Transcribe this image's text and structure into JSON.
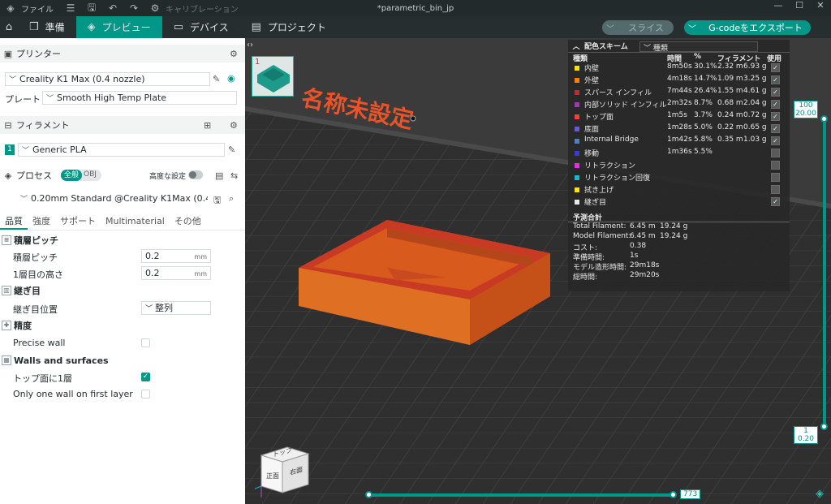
{
  "titlebar": {
    "file_label": "ファイル",
    "calibration_label": "キャリブレーション",
    "document_title": "*parametric_bin_jp"
  },
  "nav": {
    "prepare": "準備",
    "preview": "プレビュー",
    "device": "デバイス",
    "project": "プロジェクト",
    "slice": "スライス",
    "export": "G-codeをエクスポート"
  },
  "printer": {
    "section": "プリンター",
    "value": "Creality K1 Max (0.4 nozzle)",
    "plate_label": "プレート",
    "plate_value": "Smooth High Temp Plate"
  },
  "filament": {
    "section": "フィラメント",
    "index": "1",
    "value": "Generic PLA"
  },
  "process": {
    "section": "プロセス",
    "global": "全般",
    "obj": "OBJ",
    "advanced": "高度な設定",
    "preset": "0.20mm Standard @Creality K1Max (0.4 no..."
  },
  "tabs": [
    "品質",
    "強度",
    "サポート",
    "Multimaterial",
    "その他"
  ],
  "settings": {
    "layer_group": "積層ピッチ",
    "layer_height_label": "積層ピッチ",
    "layer_height": "0.2",
    "first_layer_label": "1層目の高さ",
    "first_layer": "0.2",
    "unit": "mm",
    "seam_group": "継ぎ目",
    "seam_label": "継ぎ目位置",
    "seam_value": "整列",
    "precision_group": "精度",
    "precise_wall": "Precise wall",
    "precise_wall_checked": false,
    "walls_group": "Walls and surfaces",
    "top_one_wall": "トップ面に1層",
    "top_one_wall_checked": true,
    "only_one_wall_first": "Only one wall on first layer",
    "only_one_wall_first_checked": false
  },
  "viewport": {
    "plate_number": "1",
    "plate_name": "名称未設定",
    "cube_top": "トップ",
    "cube_front": "正面",
    "cube_right": "右面",
    "layer_top": "100",
    "layer_top_h": "20.00",
    "layer_bottom": "1",
    "layer_bottom_h": "0.20",
    "move_value": "773"
  },
  "legend": {
    "title": "配色スキーム",
    "scheme": "種類",
    "cols": {
      "type": "種類",
      "time": "時間",
      "pct": "%",
      "filament": "フィラメント",
      "used": "使用"
    },
    "rows": [
      {
        "name": "内壁",
        "color": "#ffe100",
        "time": "8m50s",
        "pct": "30.1%",
        "len": "2.32 m",
        "wt": "6.93 g",
        "checked": true
      },
      {
        "name": "外壁",
        "color": "#ff7f00",
        "time": "4m18s",
        "pct": "14.7%",
        "len": "1.09 m",
        "wt": "3.25 g",
        "checked": true
      },
      {
        "name": "スパース インフィル",
        "color": "#b33030",
        "time": "7m44s",
        "pct": "26.4%",
        "len": "1.55 m",
        "wt": "4.61 g",
        "checked": true
      },
      {
        "name": "内部ソリッド インフィル",
        "color": "#9a3bb0",
        "time": "2m32s",
        "pct": "8.7%",
        "len": "0.68 m",
        "wt": "2.04 g",
        "checked": true
      },
      {
        "name": "トップ面",
        "color": "#ff3c3c",
        "time": "1m5s",
        "pct": "3.7%",
        "len": "0.24 m",
        "wt": "0.72 g",
        "checked": true
      },
      {
        "name": "底面",
        "color": "#6a5acd",
        "time": "1m28s",
        "pct": "5.0%",
        "len": "0.22 m",
        "wt": "0.65 g",
        "checked": true
      },
      {
        "name": "Internal Bridge",
        "color": "#4f7fc0",
        "time": "1m42s",
        "pct": "5.8%",
        "len": "0.35 m",
        "wt": "1.03 g",
        "checked": true
      },
      {
        "name": "移動",
        "color": "#3a3ad0",
        "time": "1m36s",
        "pct": "5.5%",
        "len": "",
        "wt": "",
        "checked": false
      },
      {
        "name": "リトラクション",
        "color": "#e030e0",
        "time": "",
        "pct": "",
        "len": "",
        "wt": "",
        "checked": false
      },
      {
        "name": "リトラクション回復",
        "color": "#27b0c8",
        "time": "",
        "pct": "",
        "len": "",
        "wt": "",
        "checked": false
      },
      {
        "name": "拭き上げ",
        "color": "#ffe600",
        "time": "",
        "pct": "",
        "len": "",
        "wt": "",
        "checked": false
      },
      {
        "name": "継ぎ目",
        "color": "#e8e8e8",
        "time": "",
        "pct": "",
        "len": "",
        "wt": "",
        "checked": true
      }
    ],
    "estimate_title": "予測合計",
    "estimates": [
      {
        "label": "Total Filament:",
        "v1": "6.45 m",
        "v2": "19.24 g"
      },
      {
        "label": "Model Filament:",
        "v1": "6.45 m",
        "v2": "19.24 g"
      },
      {
        "label": "コスト:",
        "v1": "0.38",
        "v2": ""
      },
      {
        "label": "準備時間:",
        "v1": "1s",
        "v2": ""
      },
      {
        "label": "モデル造形時間:",
        "v1": "29m18s",
        "v2": ""
      },
      {
        "label": "総時間:",
        "v1": "29m20s",
        "v2": ""
      }
    ]
  }
}
